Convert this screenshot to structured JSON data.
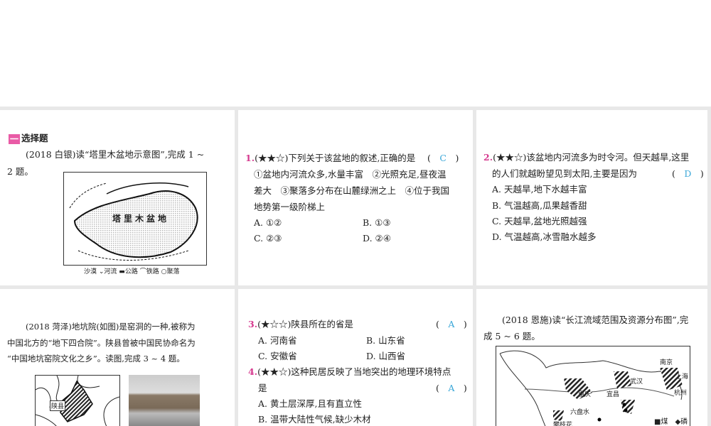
{
  "section": {
    "icon": "一",
    "title": "选择题"
  },
  "intro1": {
    "line1": "(2018 白银)读“塔里木盆地示意图”,完成 1 ~",
    "line2": "2 题。"
  },
  "map1": {
    "label": "塔里木盆地",
    "legend": [
      "沙漠",
      "河流",
      "公路",
      "铁路",
      "聚落"
    ]
  },
  "q1": {
    "num": "1.",
    "stars": "(★★☆)",
    "stem": "下列关于该盆地的叙述,正确的是",
    "answer": "C",
    "lines": [
      "①盆地内河流众多,水量丰富　②光照充足,昼夜温",
      "差大　③聚落多分布在山麓绿洲之上　④位于我国",
      "地势第一级阶梯上"
    ],
    "options": [
      "A. ①②",
      "B. ①③",
      "C. ②③",
      "D. ②④"
    ]
  },
  "q2": {
    "num": "2.",
    "stars": "(★★☆)",
    "stem": "该盆地内河流多为时令河。但天越旱,这里",
    "stem2": "的人们就越盼望见到太阳,主要是因为",
    "answer": "D",
    "options": [
      "A. 天越旱,地下水越丰富",
      "B. 气温越高,瓜果越香甜",
      "C. 天越旱,盆地光照越强",
      "D. 气温越高,冰雪融水越多"
    ]
  },
  "intro2": {
    "lines": [
      "(2018 菏泽)地坑院(如图)是窑洞的一种,被称为",
      "中国北方的“地下四合院”。陕县曾被中国民协命名为",
      "“中国地坑窑院文化之乡”。读图,完成 3 ~ 4 题。"
    ],
    "map_label": "陕县"
  },
  "q3": {
    "num": "3.",
    "stars": "(★☆☆)",
    "stem": "陕县所在的省是",
    "answer": "A",
    "options": [
      "A. 河南省",
      "B. 山东省",
      "C. 安徽省",
      "D. 山西省"
    ]
  },
  "q4": {
    "num": "4.",
    "stars": "(★★☆)",
    "stem": "这种民居反映了当地突出的地理环境特点",
    "stem2": "是",
    "answer": "A",
    "options": [
      "A. 黄土层深厚,且有直立性",
      "B. 温带大陆性气候,缺少木材"
    ]
  },
  "intro3": {
    "line1": "(2018 恩施)读“长江流域范围及资源分布图”,完",
    "line2": "成 5 ~ 6 题。",
    "cities": [
      "南京",
      "上海",
      "武汉",
      "杭州",
      "重庆",
      "宜昌",
      "六盘水",
      "攀枝花"
    ],
    "legend": [
      "煤",
      "磷"
    ]
  }
}
